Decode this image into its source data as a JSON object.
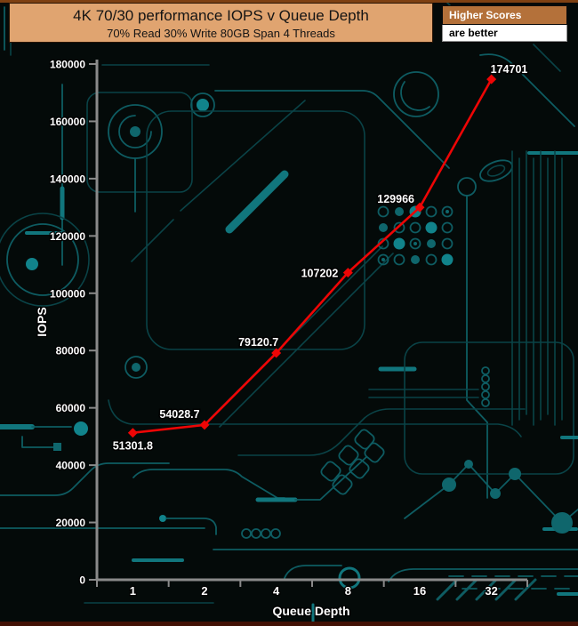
{
  "header": {
    "title": "4K 70/30 performance IOPS v Queue Depth",
    "subtitle": "70% Read 30% Write 80GB Span 4 Threads",
    "note_line1": "Higher Scores",
    "note_line2": "are better"
  },
  "colors": {
    "line": "#ee0505",
    "axis": "#8a8a8a",
    "title_bg": "#e0a470",
    "note_bg": "#b4713a",
    "trace_teal": "#0e5c62",
    "background": "#040a09"
  },
  "chart_data": {
    "type": "line",
    "title": "4K 70/30 performance IOPS v Queue Depth",
    "subtitle": "70% Read 30% Write 80GB Span 4 Threads",
    "xlabel": "Queue Depth",
    "ylabel": "IOPS",
    "categories": [
      "1",
      "2",
      "4",
      "8",
      "16",
      "32"
    ],
    "values": [
      51301.8,
      54028.7,
      79120.7,
      107202,
      129966,
      174701
    ],
    "labels": [
      "51301.8",
      "54028.7",
      "79120.7",
      "107202",
      "129966",
      "174701"
    ],
    "series_name": "IOPS",
    "ylim": [
      0,
      180000
    ],
    "ytick_step": 20000,
    "x_scale": "log2-categorical",
    "grid": false,
    "legend_position": "none"
  }
}
